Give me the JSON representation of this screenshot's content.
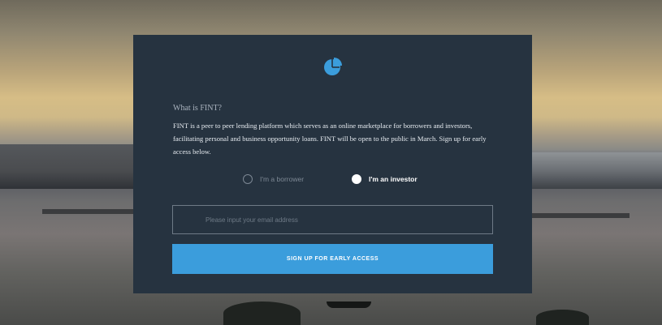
{
  "card": {
    "logo": "pie-chart-icon",
    "heading": "What is FINT?",
    "description": "FINT is a peer to peer lending platform which serves as an online marketplace for borrowers and investors, facilitating personal and business opportunity loans. FINT will be open to the public in March. Sign up for early access below."
  },
  "role_options": [
    {
      "label": "I'm a borrower",
      "selected": false
    },
    {
      "label": "I'm an investor",
      "selected": true
    }
  ],
  "email": {
    "value": "",
    "placeholder": "Please input your email address"
  },
  "signup_button": {
    "label": "SIGN UP FOR EARLY ACCESS"
  },
  "colors": {
    "card_background": "#263340",
    "button": "#3b9ddc",
    "logo": "#3b9ddc"
  }
}
